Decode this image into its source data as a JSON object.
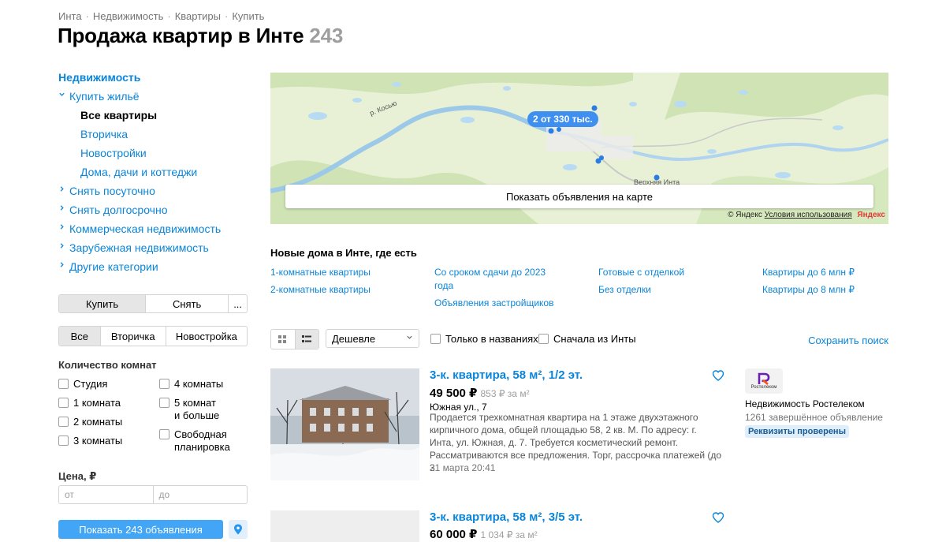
{
  "breadcrumbs": [
    "Инта",
    "Недвижимость",
    "Квартиры",
    "Купить"
  ],
  "page": {
    "title": "Продажа квартир в Инте",
    "count": "243"
  },
  "sidebar": {
    "root": "Недвижимость",
    "buy": "Купить жильё",
    "buy_sub": [
      "Все квартиры",
      "Вторичка",
      "Новостройки",
      "Дома, дачи и коттеджи"
    ],
    "items": [
      "Снять посуточно",
      "Снять долгосрочно",
      "Коммерческая недвижимость",
      "Зарубежная недвижимость",
      "Другие категории"
    ]
  },
  "deal_tabs": {
    "buy": "Купить",
    "rent": "Снять",
    "more": "..."
  },
  "market_tabs": [
    "Все",
    "Вторичка",
    "Новостройка"
  ],
  "rooms": {
    "title": "Количество комнат",
    "options": [
      "Студия",
      "1 комната",
      "2 комнаты",
      "3 комнаты",
      "4 комнаты",
      "5 комнат\nи больше",
      "Свободная\nпланировка"
    ]
  },
  "price": {
    "title": "Цена, ₽",
    "from": "от",
    "to": "до"
  },
  "show_button": "Показать 243 объявления",
  "map": {
    "cluster": "2 от 330 тыс.",
    "button": "Показать объявления на карте",
    "copyright": "© Яндекс",
    "terms": "Условия использования",
    "logo": "Яндекс",
    "labels": [
      "р. Косью",
      "Верхняя Инта"
    ]
  },
  "new_homes": {
    "title": "Новые дома в Инте, где есть",
    "links": [
      "1-комнатные квартиры",
      "2-комнатные квартиры",
      "Со сроком сдачи до 2023\nгода",
      "Объявления застройщиков",
      "Готовые с отделкой",
      "Без отделки",
      "Квартиры до 6 млн ₽",
      "Квартиры до 8 млн ₽"
    ]
  },
  "toolbar": {
    "sort": "Дешевле",
    "only_titles": "Только в названиях",
    "first_inta": "Сначала из Инты",
    "save_search": "Сохранить поиск"
  },
  "listings": [
    {
      "title": "3-к. квартира, 58 м², 1/2 эт.",
      "price": "49 500 ₽",
      "ppm": "853 ₽ за м²",
      "address": "Южная ул., 7",
      "description": "Продается трехкомнатная квартира на 1 этаже двухэтажного кирпичного дома, общей площадью 58, 2 кв. М. По адресу: г. Инта, ул. Южная, д. 7. Требуется косметический ремонт. Рассматриваются все предложения. Торг, рассрочка платежей (до 3",
      "date": "21 марта 20:41",
      "seller": {
        "logo_text": "Ростелеком",
        "name": "Недвижимость Ростелеком",
        "sub": "1261 завершённое объявление",
        "badge": "Реквизиты проверены"
      }
    },
    {
      "title": "3-к. квартира, 58 м², 3/5 эт.",
      "price": "60 000 ₽",
      "ppm": "1 034 ₽ за м²"
    }
  ],
  "colors": {
    "link": "#0a85d9",
    "primary_button": "#42a5f5",
    "map_cluster": "#3e8ff0",
    "badge_bg": "#dfeefb"
  }
}
